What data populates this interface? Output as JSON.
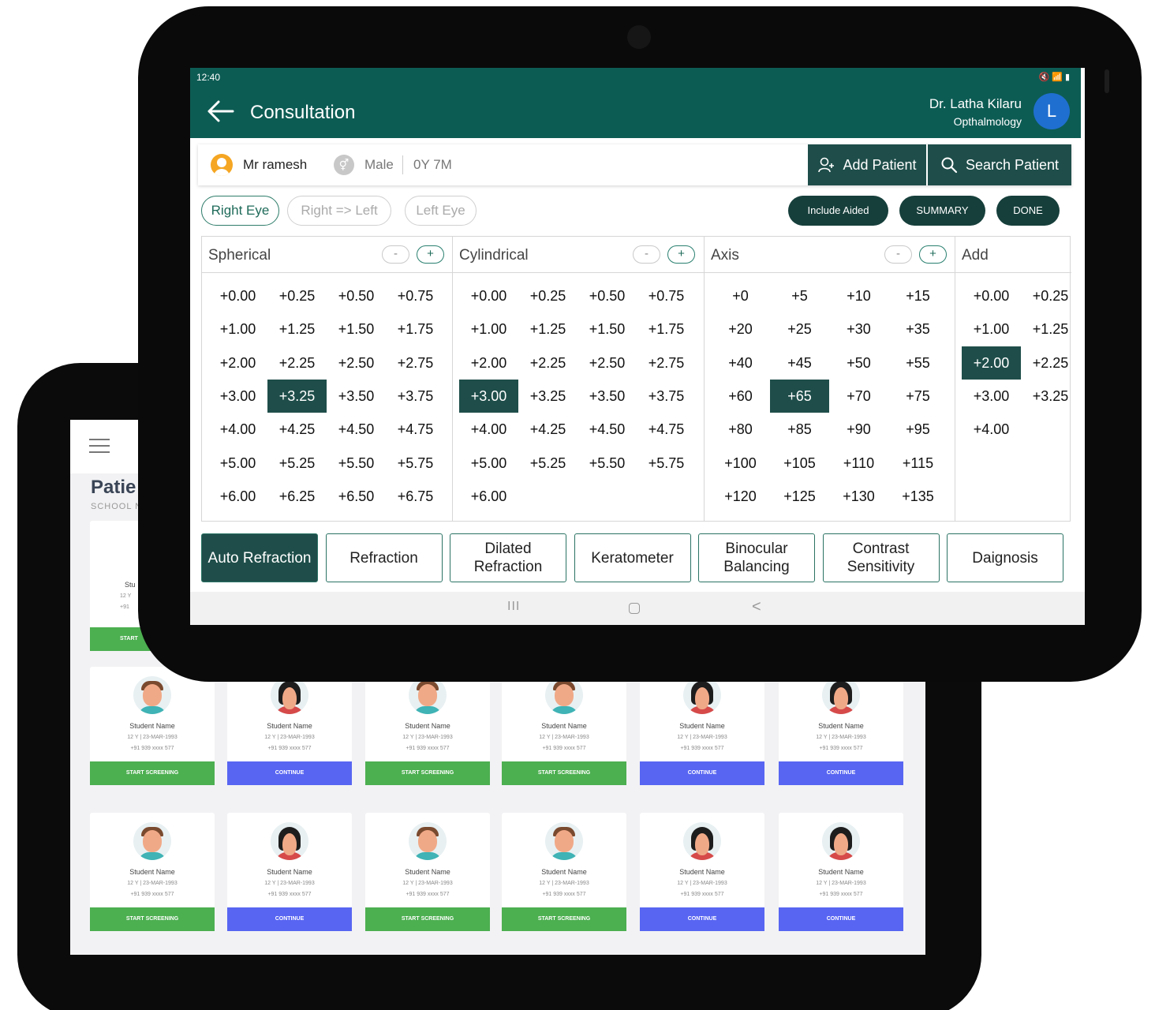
{
  "status_bar": {
    "time": "12:40",
    "icons": "🔇 📶 ▮"
  },
  "app_bar": {
    "title": "Consultation",
    "doctor_name": "Dr. Latha Kilaru",
    "doctor_specialty": "Opthalmology",
    "doctor_initial": "L"
  },
  "patient": {
    "name": "Mr ramesh",
    "gender": "Male",
    "age": "0Y 7M"
  },
  "actions": {
    "add_patient": "Add Patient",
    "search_patient": "Search Patient"
  },
  "eye_tabs": [
    {
      "label": "Right Eye",
      "active": true
    },
    {
      "label": "Right  =>  Left",
      "active": false
    },
    {
      "label": "Left Eye",
      "active": false
    }
  ],
  "pills": {
    "include_aided": "Include Aided",
    "summary": "SUMMARY",
    "done": "DONE"
  },
  "panels": [
    {
      "title": "Spherical",
      "minus": "-",
      "plus": "+",
      "selected": "+3.25",
      "values": [
        "+0.00",
        "+0.25",
        "+0.50",
        "+0.75",
        "+1.00",
        "+1.25",
        "+1.50",
        "+1.75",
        "+2.00",
        "+2.25",
        "+2.50",
        "+2.75",
        "+3.00",
        "+3.25",
        "+3.50",
        "+3.75",
        "+4.00",
        "+4.25",
        "+4.50",
        "+4.75",
        "+5.00",
        "+5.25",
        "+5.50",
        "+5.75",
        "+6.00",
        "+6.25",
        "+6.50",
        "+6.75"
      ]
    },
    {
      "title": "Cylindrical",
      "minus": "-",
      "plus": "+",
      "selected": "+3.00",
      "values": [
        "+0.00",
        "+0.25",
        "+0.50",
        "+0.75",
        "+1.00",
        "+1.25",
        "+1.50",
        "+1.75",
        "+2.00",
        "+2.25",
        "+2.50",
        "+2.75",
        "+3.00",
        "+3.25",
        "+3.50",
        "+3.75",
        "+4.00",
        "+4.25",
        "+4.50",
        "+4.75",
        "+5.00",
        "+5.25",
        "+5.50",
        "+5.75",
        "+6.00"
      ]
    },
    {
      "title": "Axis",
      "minus": "-",
      "plus": "+",
      "selected": "+65",
      "values": [
        "+0",
        "+5",
        "+10",
        "+15",
        "+20",
        "+25",
        "+30",
        "+35",
        "+40",
        "+45",
        "+50",
        "+55",
        "+60",
        "+65",
        "+70",
        "+75",
        "+80",
        "+85",
        "+90",
        "+95",
        "+100",
        "+105",
        "+110",
        "+115",
        "+120",
        "+125",
        "+130",
        "+135"
      ]
    },
    {
      "title": "Add",
      "selected": "+2.00",
      "values": [
        "+0.00",
        "+0.25",
        "+1.00",
        "+1.25",
        "+2.00",
        "+2.25",
        "+3.00",
        "+3.25",
        "+4.00"
      ]
    }
  ],
  "function_tabs": [
    {
      "label": "Auto Refraction",
      "active": true
    },
    {
      "label": "Refraction",
      "active": false
    },
    {
      "label": "Dilated Refraction",
      "active": false
    },
    {
      "label": "Keratometer",
      "active": false
    },
    {
      "label": "Binocular Balancing",
      "active": false
    },
    {
      "label": "Contrast Sensitivity",
      "active": false
    },
    {
      "label": "Daignosis",
      "active": false
    }
  ],
  "nav": {
    "recent": "III",
    "back": "<"
  },
  "back_screen": {
    "title": "Patie",
    "subtitle": "SCHOOL N",
    "cards": [
      {
        "name": "Student Name",
        "line2": "12 Y | 23-MAR-1993",
        "line3": "+91 939 xxxx 577",
        "button": "START SCREENING",
        "style": "g",
        "gender": "m"
      },
      {
        "name": "Student Name",
        "line2": "12 Y | 23-MAR-1993",
        "line3": "+91 939 xxxx 577",
        "button": "CONTINUE",
        "style": "b",
        "gender": "f"
      },
      {
        "name": "Student Name",
        "line2": "12 Y | 23-MAR-1993",
        "line3": "+91 939 xxxx 577",
        "button": "START SCREENING",
        "style": "g",
        "gender": "m"
      },
      {
        "name": "Student Name",
        "line2": "12 Y | 23-MAR-1993",
        "line3": "+91 939 xxxx 577",
        "button": "START SCREENING",
        "style": "g",
        "gender": "m"
      },
      {
        "name": "Student Name",
        "line2": "12 Y | 23-MAR-1993",
        "line3": "+91 939 xxxx 577",
        "button": "CONTINUE",
        "style": "b",
        "gender": "f"
      },
      {
        "name": "Student Name",
        "line2": "12 Y | 23-MAR-1993",
        "line3": "+91 939 xxxx 577",
        "button": "CONTINUE",
        "style": "b",
        "gender": "f"
      },
      {
        "name": "Student Name",
        "line2": "12 Y | 23-MAR-1993",
        "line3": "+91 939 xxxx 577",
        "button": "START SCREENING",
        "style": "g",
        "gender": "m"
      },
      {
        "name": "Student Name",
        "line2": "12 Y | 23-MAR-1993",
        "line3": "+91 939 xxxx 577",
        "button": "CONTINUE",
        "style": "b",
        "gender": "f"
      },
      {
        "name": "Student Name",
        "line2": "12 Y | 23-MAR-1993",
        "line3": "+91 939 xxxx 577",
        "button": "START SCREENING",
        "style": "g",
        "gender": "m"
      },
      {
        "name": "Student Name",
        "line2": "12 Y | 23-MAR-1993",
        "line3": "+91 939 xxxx 577",
        "button": "START SCREENING",
        "style": "g",
        "gender": "m"
      },
      {
        "name": "Student Name",
        "line2": "12 Y | 23-MAR-1993",
        "line3": "+91 939 xxxx 577",
        "button": "CONTINUE",
        "style": "b",
        "gender": "f"
      },
      {
        "name": "Student Name",
        "line2": "12 Y | 23-MAR-1993",
        "line3": "+91 939 xxxx 577",
        "button": "CONTINUE",
        "style": "b",
        "gender": "f"
      }
    ],
    "partial_card": {
      "name": "Stu",
      "line2": "12 Y",
      "line3": "+91",
      "button": "START"
    }
  },
  "colors": {
    "primary": "#0d5c54",
    "dark_button": "#1f4e4a",
    "accent_blue": "#1f6fd0",
    "green": "#4caf50",
    "indigo": "#5865f2"
  }
}
